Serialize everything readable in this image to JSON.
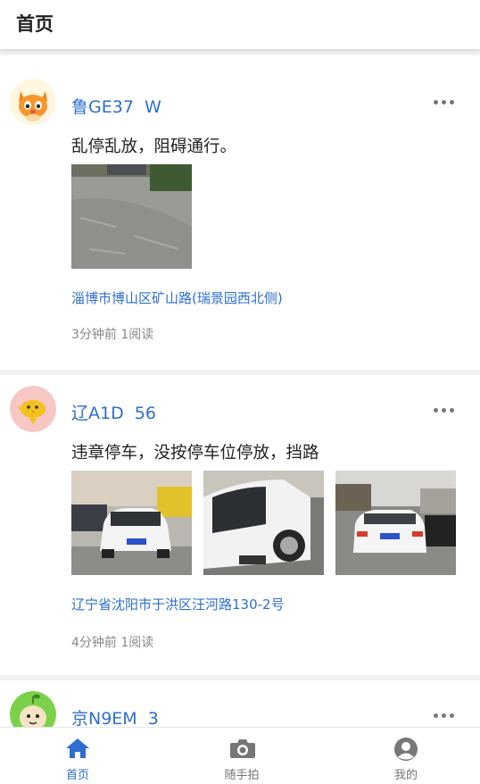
{
  "header": {
    "title": "首页"
  },
  "posts": [
    {
      "plate": "鲁GE37  W",
      "description": "乱停乱放，阻碍通行。",
      "location": "淄博市博山区矿山路(瑞景园西北侧)",
      "meta": "3分钟前 1阅读",
      "avatar": "cat-avatar"
    },
    {
      "plate": "辽A1D  56",
      "description": "违章停车，没按停车位停放，挡路",
      "location": "辽宁省沈阳市于洪区汪河路130-2号",
      "meta": "4分钟前 1阅读",
      "avatar": "yellow-bird-avatar"
    },
    {
      "plate": "京N9EM  3",
      "avatar": "green-sprout-avatar"
    }
  ],
  "tabbar": {
    "items": [
      {
        "label": "首页",
        "icon": "home-icon",
        "active": true
      },
      {
        "label": "随手拍",
        "icon": "camera-icon",
        "active": false
      },
      {
        "label": "我的",
        "icon": "profile-icon",
        "active": false
      }
    ]
  },
  "colors": {
    "accent": "#2d6fcf",
    "text": "#222222",
    "muted": "#888888"
  }
}
